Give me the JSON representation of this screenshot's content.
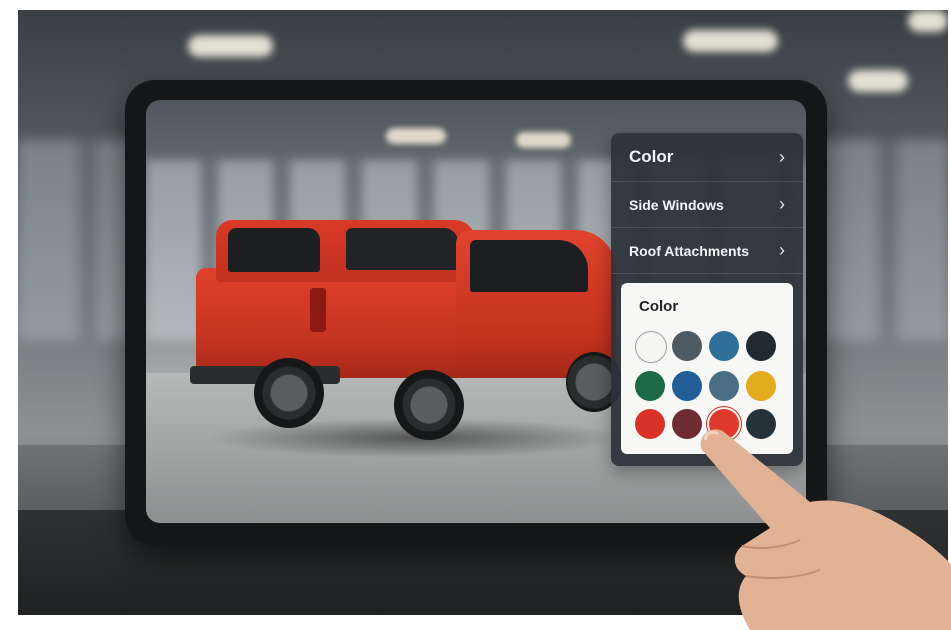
{
  "config_menu": {
    "items": [
      {
        "label": "Color"
      },
      {
        "label": "Side Windows"
      },
      {
        "label": "Roof Attachments"
      }
    ],
    "chevron_icon": "chevron-right-icon"
  },
  "color_picker": {
    "title": "Color",
    "swatches": [
      {
        "color": "#f5f5f2",
        "name": "white"
      },
      {
        "color": "#4d5a62",
        "name": "slate-gray"
      },
      {
        "color": "#2f6f98",
        "name": "ocean-blue"
      },
      {
        "color": "#1f2a33",
        "name": "midnight"
      },
      {
        "color": "#1e6a46",
        "name": "forest-green"
      },
      {
        "color": "#215d96",
        "name": "blue"
      },
      {
        "color": "#4a6f85",
        "name": "steel-blue"
      },
      {
        "color": "#e3ab1e",
        "name": "mustard-yellow"
      },
      {
        "color": "#d7332a",
        "name": "red"
      },
      {
        "color": "#6e2b31",
        "name": "burgundy"
      },
      {
        "color": "#e0392e",
        "name": "bright-red",
        "selected": true
      },
      {
        "color": "#26323a",
        "name": "charcoal"
      }
    ]
  },
  "vehicle_color": "#d93a26"
}
